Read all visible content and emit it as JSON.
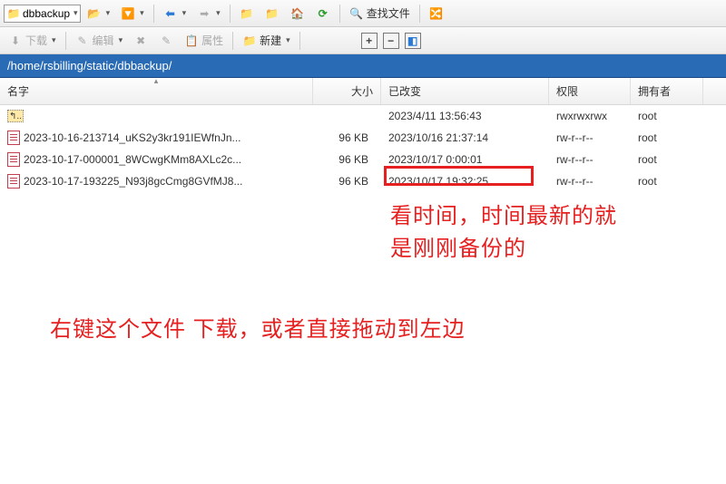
{
  "toolbar1": {
    "tab_label": "dbbackup",
    "find_label": "查找文件"
  },
  "toolbar2": {
    "download_label": "下载",
    "edit_label": "编辑",
    "props_label": "属性",
    "new_label": "新建"
  },
  "path": "/home/rsbilling/static/dbbackup/",
  "columns": {
    "name": "名字",
    "size": "大小",
    "changed": "已改变",
    "perm": "权限",
    "owner": "拥有者"
  },
  "updir": {
    "date": "2023/4/11 13:56:43",
    "perm": "rwxrwxrwx",
    "owner": "root"
  },
  "files": [
    {
      "name": "2023-10-16-213714_uKS2y3kr191IEWfnJn...",
      "size": "96 KB",
      "date": "2023/10/16 21:37:14",
      "perm": "rw-r--r--",
      "owner": "root"
    },
    {
      "name": "2023-10-17-000001_8WCwgKMm8AXLc2c...",
      "size": "96 KB",
      "date": "2023/10/17 0:00:01",
      "perm": "rw-r--r--",
      "owner": "root"
    },
    {
      "name": "2023-10-17-193225_N93j8gcCmg8GVfMJ8...",
      "size": "96 KB",
      "date": "2023/10/17 19:32:25",
      "perm": "rw-r--r--",
      "owner": "root"
    }
  ],
  "annotations": {
    "line1": "看时间，时间最新的就",
    "line2": "是刚刚备份的",
    "line3": "右键这个文件 下载，或者直接拖动到左边"
  }
}
